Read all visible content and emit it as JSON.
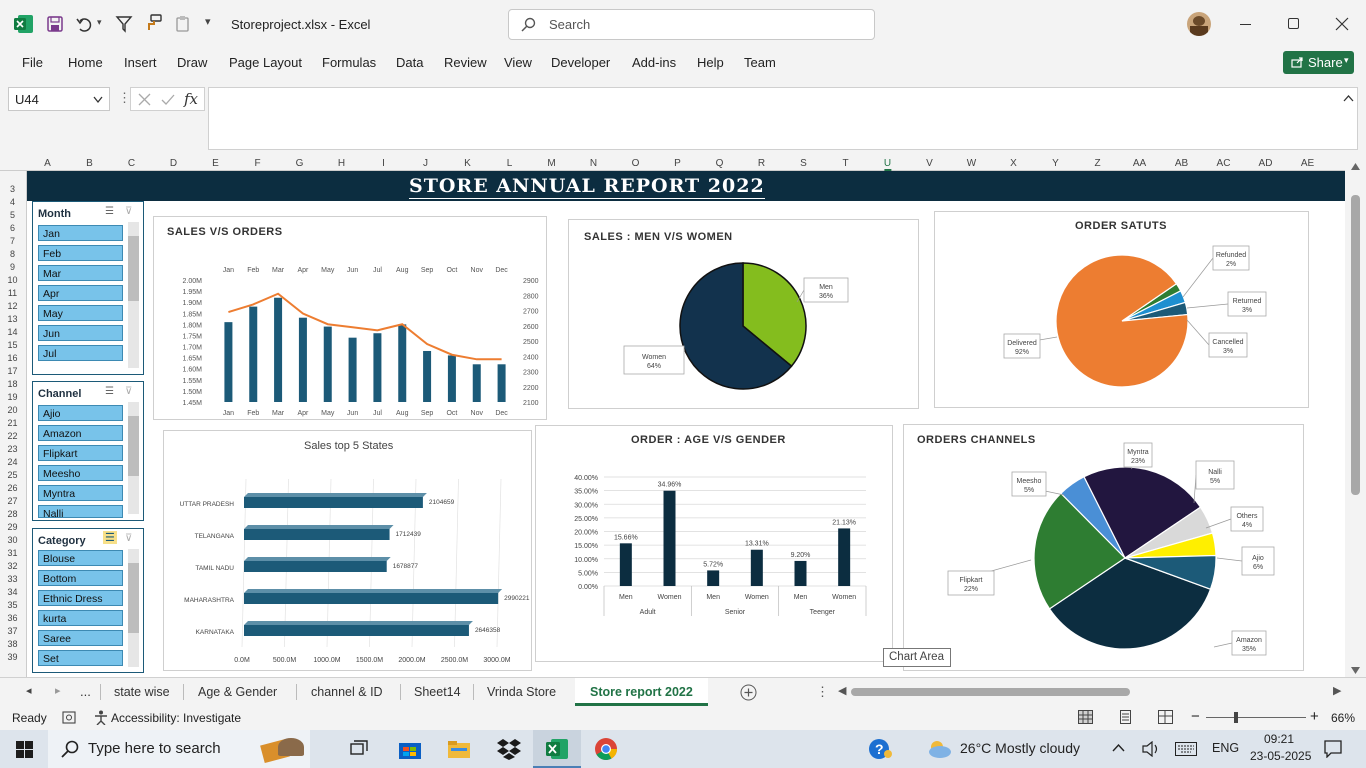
{
  "titlebar": {
    "filename": "Storeproject.xlsx",
    "sep": " - ",
    "app": "Excel",
    "search_placeholder": "Search"
  },
  "ribbon": {
    "tabs": [
      "File",
      "Home",
      "Insert",
      "Draw",
      "Page Layout",
      "Formulas",
      "Data",
      "Review",
      "View",
      "Developer",
      "Add-ins",
      "Help",
      "Team"
    ],
    "share": "Share"
  },
  "formula": {
    "namebox": "U44",
    "value": ""
  },
  "columns": [
    "A",
    "B",
    "C",
    "D",
    "E",
    "F",
    "G",
    "H",
    "I",
    "J",
    "K",
    "L",
    "M",
    "N",
    "O",
    "P",
    "Q",
    "R",
    "S",
    "T",
    "U",
    "V",
    "W",
    "X",
    "Y",
    "Z",
    "AA",
    "AB",
    "AC",
    "AD",
    "AE"
  ],
  "rows": [
    "3",
    "4",
    "5",
    "6",
    "7",
    "8",
    "9",
    "10",
    "11",
    "12",
    "13",
    "14",
    "15",
    "16",
    "17",
    "18",
    "19",
    "20",
    "21",
    "22",
    "23",
    "24",
    "25",
    "26",
    "27",
    "28",
    "29",
    "30",
    "31",
    "32",
    "33",
    "34",
    "35",
    "36",
    "37",
    "38",
    "39"
  ],
  "report_title": "STORE ANNUAL REPORT  2022",
  "slicers": {
    "month": {
      "title": "Month",
      "items": [
        "Jan",
        "Feb",
        "Mar",
        "Apr",
        "May",
        "Jun",
        "Jul"
      ]
    },
    "channel": {
      "title": "Channel",
      "items": [
        "Ajio",
        "Amazon",
        "Flipkart",
        "Meesho",
        "Myntra",
        "Nalli"
      ]
    },
    "category": {
      "title": "Category",
      "items": [
        "Blouse",
        "Bottom",
        "Ethnic Dress",
        "kurta",
        "Saree",
        "Set"
      ]
    }
  },
  "tooltip": "Chart Area",
  "sheet_tabs": [
    "state wise",
    "Age & Gender",
    "channel & ID",
    "Sheet14",
    "Vrinda Store",
    "Store report 2022"
  ],
  "tabs_more": "...",
  "status": {
    "ready": "Ready",
    "accessibility": "Accessibility: Investigate",
    "zoom": "66%",
    "minus": "−",
    "plus": "+"
  },
  "taskbar": {
    "search": "Type here to search",
    "weather": "26°C  Mostly cloudy",
    "lang": "ENG",
    "time": "09:21",
    "date": "23-05-2025"
  },
  "colors": {
    "navy": "#0c2d40",
    "bar": "#1c5a78",
    "orange": "#ed7d31",
    "green": "#84bd1e",
    "slicer": "#78c3ea",
    "excel": "#217346"
  },
  "chart_data": [
    {
      "type": "bar",
      "title": "SALES V/S ORDERS",
      "categories": [
        "Jan",
        "Feb",
        "Mar",
        "Apr",
        "May",
        "Jun",
        "Jul",
        "Aug",
        "Sep",
        "Oct",
        "Nov",
        "Dec"
      ],
      "series": [
        {
          "values": [
            1.81,
            1.88,
            1.92,
            1.83,
            1.79,
            1.74,
            1.76,
            1.8,
            1.68,
            1.66,
            1.62,
            1.62
          ]
        },
        {
          "type": "line",
          "values": [
            2690,
            2740,
            2810,
            2680,
            2610,
            2590,
            2570,
            2610,
            2480,
            2410,
            2380,
            2380
          ]
        }
      ],
      "ylim": [
        1.45,
        2.0
      ],
      "y_ticks": [
        "2.00M",
        "1.95M",
        "1.90M",
        "1.85M",
        "1.80M",
        "1.75M",
        "1.70M",
        "1.65M",
        "1.60M",
        "1.55M",
        "1.50M",
        "1.45M"
      ],
      "y2lim": [
        2100,
        2900
      ],
      "y2_ticks": [
        "2900",
        "2800",
        "2700",
        "2600",
        "2500",
        "2400",
        "2300",
        "2200",
        "2100"
      ]
    },
    {
      "type": "pie",
      "title": "SALES : MEN V/S WOMEN",
      "slices": [
        {
          "label": "Men",
          "value": 36,
          "text": "36%"
        },
        {
          "label": "Women",
          "value": 64,
          "text": "64%"
        }
      ]
    },
    {
      "type": "pie",
      "title": "ORDER SATUTS",
      "slices": [
        {
          "label": "Delivered",
          "value": 92,
          "text": "92%"
        },
        {
          "label": "Refunded",
          "value": 2,
          "text": "2%"
        },
        {
          "label": "Returned",
          "value": 3,
          "text": "3%"
        },
        {
          "label": "Cancelled",
          "value": 3,
          "text": "3%"
        }
      ]
    },
    {
      "type": "bar",
      "title": "Sales top 5 States",
      "orientation": "horizontal",
      "categories": [
        "UTTAR PRADESH",
        "TELANGANA",
        "TAMIL NADU",
        "MAHARASHTRA",
        "KARNATAKA"
      ],
      "values": [
        2104659,
        1712439,
        1678877,
        2990221,
        2646358
      ],
      "x_ticks": [
        "0.0M",
        "500.0M",
        "1000.0M",
        "1500.0M",
        "2000.0M",
        "2500.0M",
        "3000.0M"
      ]
    },
    {
      "type": "bar",
      "title": "ORDER : AGE V/S GENDER",
      "categories": [
        "Men",
        "Women",
        "Men",
        "Women",
        "Men",
        "Women"
      ],
      "groups": [
        "Adult",
        "Senior",
        "Teenger"
      ],
      "values": [
        15.66,
        34.96,
        5.72,
        13.31,
        9.2,
        21.13
      ],
      "labels": [
        "15.66%",
        "34.96%",
        "5.72%",
        "13.31%",
        "9.20%",
        "21.13%"
      ],
      "y_ticks": [
        "40.00%",
        "35.00%",
        "30.00%",
        "25.00%",
        "20.00%",
        "15.00%",
        "10.00%",
        "5.00%",
        "0.00%"
      ],
      "ylim": [
        0,
        40
      ]
    },
    {
      "type": "pie",
      "title": "ORDERS CHANNELS",
      "slices": [
        {
          "label": "Amazon",
          "value": 35,
          "text": "35%"
        },
        {
          "label": "Flipkart",
          "value": 22,
          "text": "22%"
        },
        {
          "label": "Meesho",
          "value": 5,
          "text": "5%"
        },
        {
          "label": "Myntra",
          "value": 23,
          "text": "23%"
        },
        {
          "label": "Nalli",
          "value": 5,
          "text": "5%"
        },
        {
          "label": "Others",
          "value": 4,
          "text": "4%"
        },
        {
          "label": "Ajio",
          "value": 6,
          "text": "6%"
        }
      ]
    }
  ]
}
